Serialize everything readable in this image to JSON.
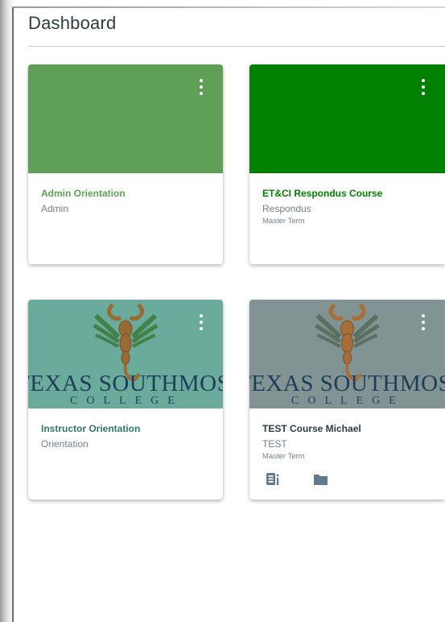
{
  "page": {
    "title": "Dashboard"
  },
  "colors": {
    "admin_hero": "#609f57",
    "respondus_hero": "#028001",
    "instructor_hero": "#6aab9c",
    "test_hero": "#819392",
    "text_muted": "#73818c",
    "logo_navy": "#1f3d5a",
    "scorpion_brown": "#9a6a36",
    "leaf_green": "#3d7a3a"
  },
  "cards": [
    {
      "title": "Admin Orientation",
      "subtitle": "Admin",
      "term": "",
      "title_color": "#609f57",
      "hero_type": "solid",
      "menu_icon": "kebab-menu-icon"
    },
    {
      "title": "ET&CI Respondus Course",
      "subtitle": "Respondus",
      "term": "Master Term",
      "title_color": "#028001",
      "hero_type": "solid",
      "menu_icon": "kebab-menu-icon"
    },
    {
      "title": "Instructor Orientation",
      "subtitle": "Orientation",
      "term": "",
      "title_color": "#2f7a67",
      "hero_type": "logo",
      "logo_text": "TEXAS SOUTHMOST",
      "logo_sub": "COLLEGE",
      "menu_icon": "kebab-menu-icon"
    },
    {
      "title": "TEST Course Michael",
      "subtitle": "TEST",
      "term": "Master Term",
      "title_color": "#2d3b45",
      "hero_type": "logo",
      "logo_text": "TEXAS SOUTHMOST",
      "logo_sub": "COLLEGE",
      "menu_icon": "kebab-menu-icon",
      "actions": [
        "announcements-icon",
        "files-folder-icon"
      ]
    }
  ]
}
